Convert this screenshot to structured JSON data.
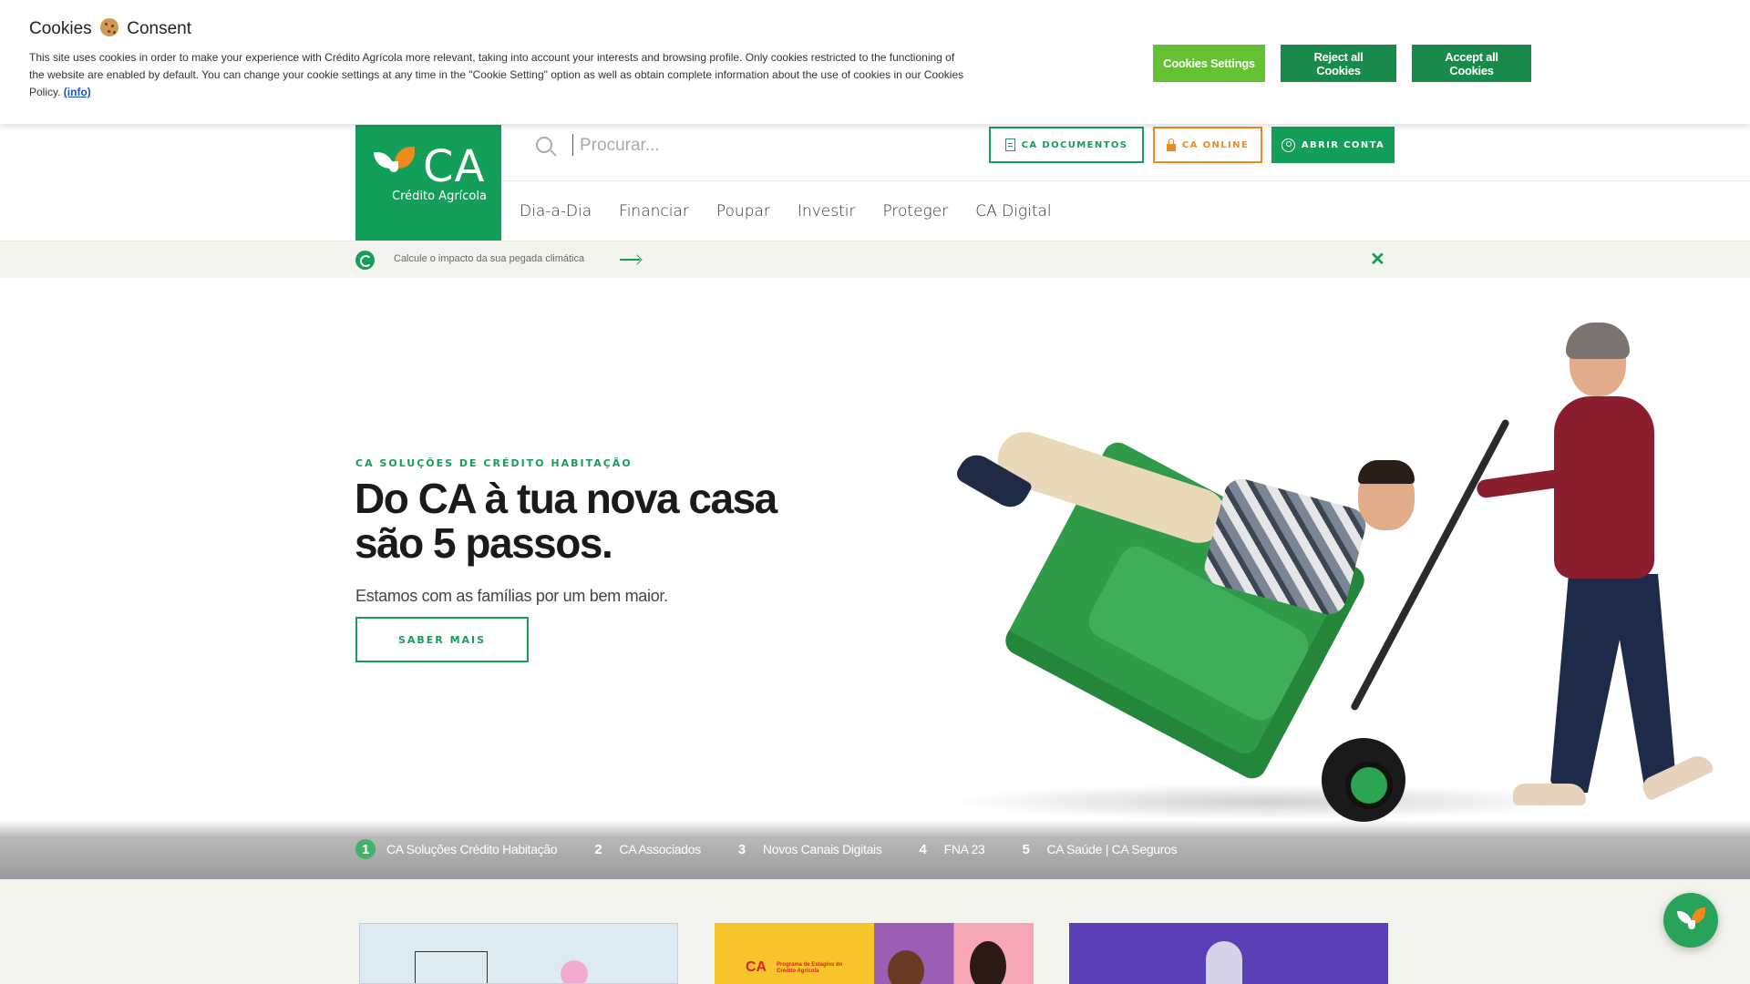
{
  "cookie_banner": {
    "title_before": "Cookies",
    "title_after": "Consent",
    "text": "This site uses cookies in order to make your experience with Crédito Agrícola more relevant, taking into account your interests and browsing profile. Only cookies restricted to the functioning of the website are enabled by default. You can change your cookie settings at any time in the \"Cookie Setting\" option as well as obtain complete information about the use of cookies in our Cookies Policy.",
    "info_link": "(info)",
    "settings_label": "Cookies Settings",
    "reject_label": "Reject all Cookies",
    "accept_label": "Accept all Cookies"
  },
  "logo": {
    "mark": "CA",
    "subtitle": "Crédito Agrícola"
  },
  "search": {
    "placeholder": "Procurar..."
  },
  "header_buttons": {
    "documents": "CA DOCUMENTOS",
    "online": "CA ONLINE",
    "open_account": "ABRIR CONTA"
  },
  "nav": {
    "items": [
      "Dia-a-Dia",
      "Financiar",
      "Poupar",
      "Investir",
      "Proteger",
      "CA Digital"
    ]
  },
  "climate": {
    "text": "Calcule o impacto da sua pegada climática"
  },
  "hero": {
    "eyebrow": "CA SOLUÇÕES DE CRÉDITO HABITAÇÃO",
    "title_line1": "Do CA à tua nova casa",
    "title_line2": "são 5 passos.",
    "subtitle": "Estamos com as famílias por um bem maior.",
    "cta": "SABER MAIS"
  },
  "steps": [
    {
      "num": "1",
      "label": "CA Soluções Crédito Habitação"
    },
    {
      "num": "2",
      "label": "CA Associados"
    },
    {
      "num": "3",
      "label": "Novos Canais Digitais"
    },
    {
      "num": "4",
      "label": "FNA 23"
    },
    {
      "num": "5",
      "label": "CA Saúde | CA Seguros"
    }
  ],
  "cards": {
    "card2_brand": "CA",
    "card2_sub": "Programa de Estágios do Crédito Agrícola"
  },
  "colors": {
    "brand_green": "#139f5a",
    "brand_orange": "#f18a1d",
    "cookie_settings": "#63c132",
    "cookie_reject_accept": "#188a4b"
  }
}
